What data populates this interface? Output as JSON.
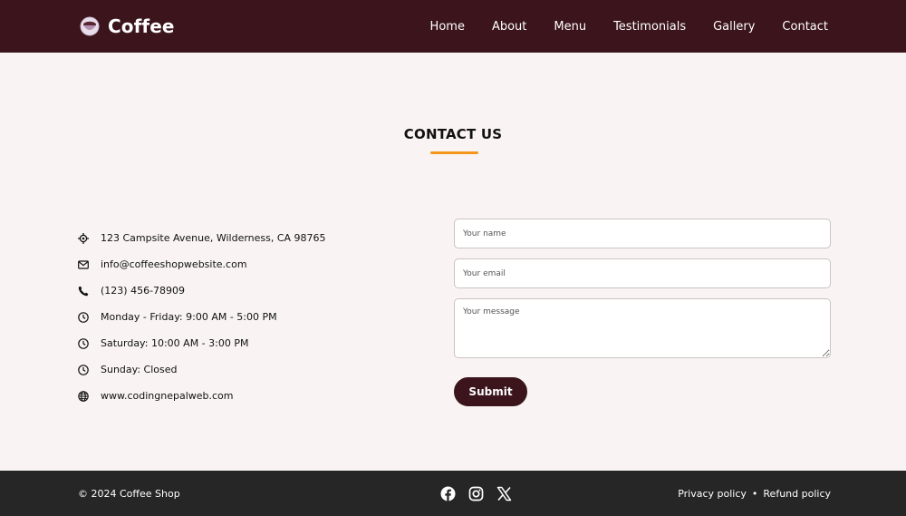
{
  "navbar": {
    "brand": "Coffee",
    "links": [
      "Home",
      "About",
      "Menu",
      "Testimonials",
      "Gallery",
      "Contact"
    ]
  },
  "contact": {
    "title": "CONTACT US",
    "info": [
      {
        "icon": "location-icon",
        "text": "123 Campsite Avenue, Wilderness, CA 98765"
      },
      {
        "icon": "email-icon",
        "text": "info@coffeeshopwebsite.com"
      },
      {
        "icon": "phone-icon",
        "text": "(123) 456-78909"
      },
      {
        "icon": "clock-icon",
        "text": "Monday - Friday: 9:00 AM - 5:00 PM"
      },
      {
        "icon": "clock-icon",
        "text": "Saturday: 10:00 AM - 3:00 PM"
      },
      {
        "icon": "clock-icon",
        "text": "Sunday: Closed"
      },
      {
        "icon": "globe-icon",
        "text": "www.codingnepalweb.com"
      }
    ],
    "form": {
      "name_placeholder": "Your name",
      "email_placeholder": "Your email",
      "message_placeholder": "Your message",
      "submit_label": "Submit"
    }
  },
  "footer": {
    "copyright": "© 2024 Coffee Shop",
    "social": [
      "facebook-icon",
      "instagram-icon",
      "x-icon"
    ],
    "policy_links": [
      "Privacy policy",
      "Refund policy"
    ],
    "separator": "•"
  },
  "colors": {
    "primary": "#3b141c",
    "accent": "#f3961c",
    "background": "#f9f4f3",
    "footer": "#262626"
  }
}
